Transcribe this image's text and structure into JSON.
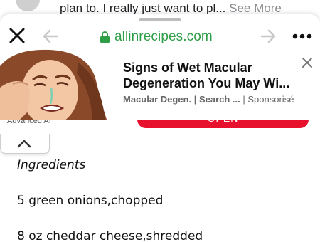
{
  "feed": {
    "snippet_text": "plan to. I really just want to pl...",
    "see_more": "See More"
  },
  "browser": {
    "url": "allinrecipes.com",
    "icons": [
      "close-icon",
      "back-arrow-icon",
      "lock-icon",
      "forward-arrow-icon",
      "more-dots-icon"
    ],
    "url_color": "#2e9e47"
  },
  "ad": {
    "title": "Signs of Wet Macular Degeneration You May Wi...",
    "source": "Macular Degen. | Search ...",
    "sponsored": "| Sponsorisé"
  },
  "page": {
    "advertiser_label": "Advanced AI",
    "open_button": "OPEN",
    "open_button_color": "#e8112d"
  },
  "recipe": {
    "heading": "Ingredients",
    "items": [
      "5 green onions,chopped",
      "8 oz cheddar cheese,shredded"
    ]
  }
}
